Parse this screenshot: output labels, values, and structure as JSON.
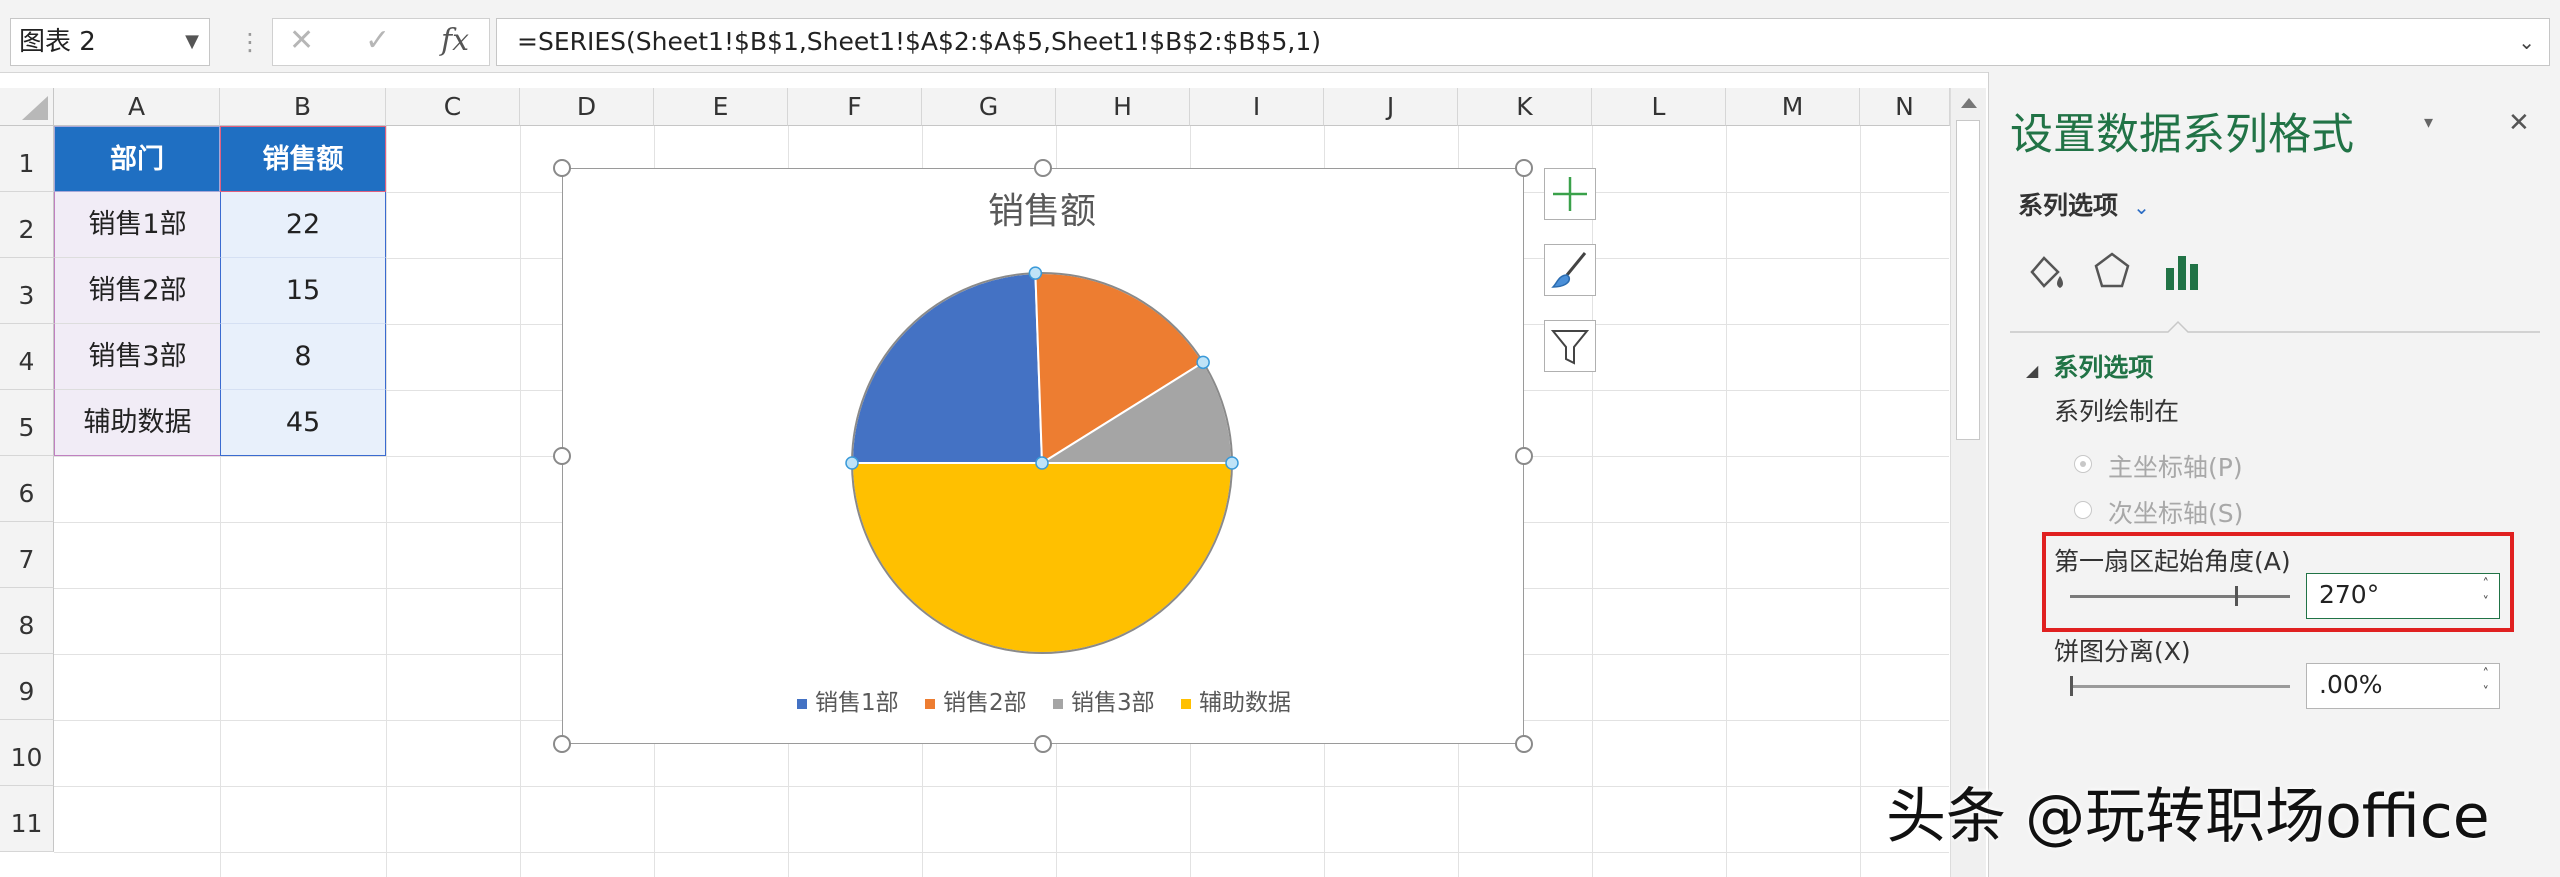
{
  "formula_bar": {
    "name_box": "图表 2",
    "cancel": "✕",
    "confirm": "✓",
    "fx": "fx",
    "formula": "=SERIES(Sheet1!$B$1,Sheet1!$A$2:$A$5,Sheet1!$B$2:$B$5,1)"
  },
  "columns": [
    "A",
    "B",
    "C",
    "D",
    "E",
    "F",
    "G",
    "H",
    "I",
    "J",
    "K",
    "L",
    "M",
    "N"
  ],
  "rows": [
    "1",
    "2",
    "3",
    "4",
    "5",
    "6",
    "7",
    "8",
    "9",
    "10",
    "11"
  ],
  "table": {
    "headers": [
      "部门",
      "销售额"
    ],
    "rows": [
      [
        "销售1部",
        "22"
      ],
      [
        "销售2部",
        "15"
      ],
      [
        "销售3部",
        "8"
      ],
      [
        "辅助数据",
        "45"
      ]
    ]
  },
  "chart_data": {
    "type": "pie",
    "title": "销售额",
    "categories": [
      "销售1部",
      "销售2部",
      "销售3部",
      "辅助数据"
    ],
    "values": [
      22,
      15,
      8,
      45
    ],
    "colors": [
      "#4472C4",
      "#ED7D31",
      "#A5A5A5",
      "#FFC000"
    ],
    "start_angle_deg": 270,
    "legend_position": "bottom"
  },
  "pane": {
    "title": "设置数据系列格式",
    "options_dropdown": "系列选项",
    "section": "系列选项",
    "plot_on": "系列绘制在",
    "primary_axis": "主坐标轴(P)",
    "secondary_axis": "次坐标轴(S)",
    "first_slice_angle": "第一扇区起始角度(A)",
    "first_slice_value": "270°",
    "explosion": "饼图分离(X)",
    "explosion_value": ".00%",
    "first_slice_fraction": 0.75,
    "explosion_fraction": 0
  },
  "watermark": "头条 @玩转职场office",
  "colors": {
    "accent_green": "#217346",
    "header_blue": "#1f6fc2",
    "highlight_red": "#e02020"
  }
}
